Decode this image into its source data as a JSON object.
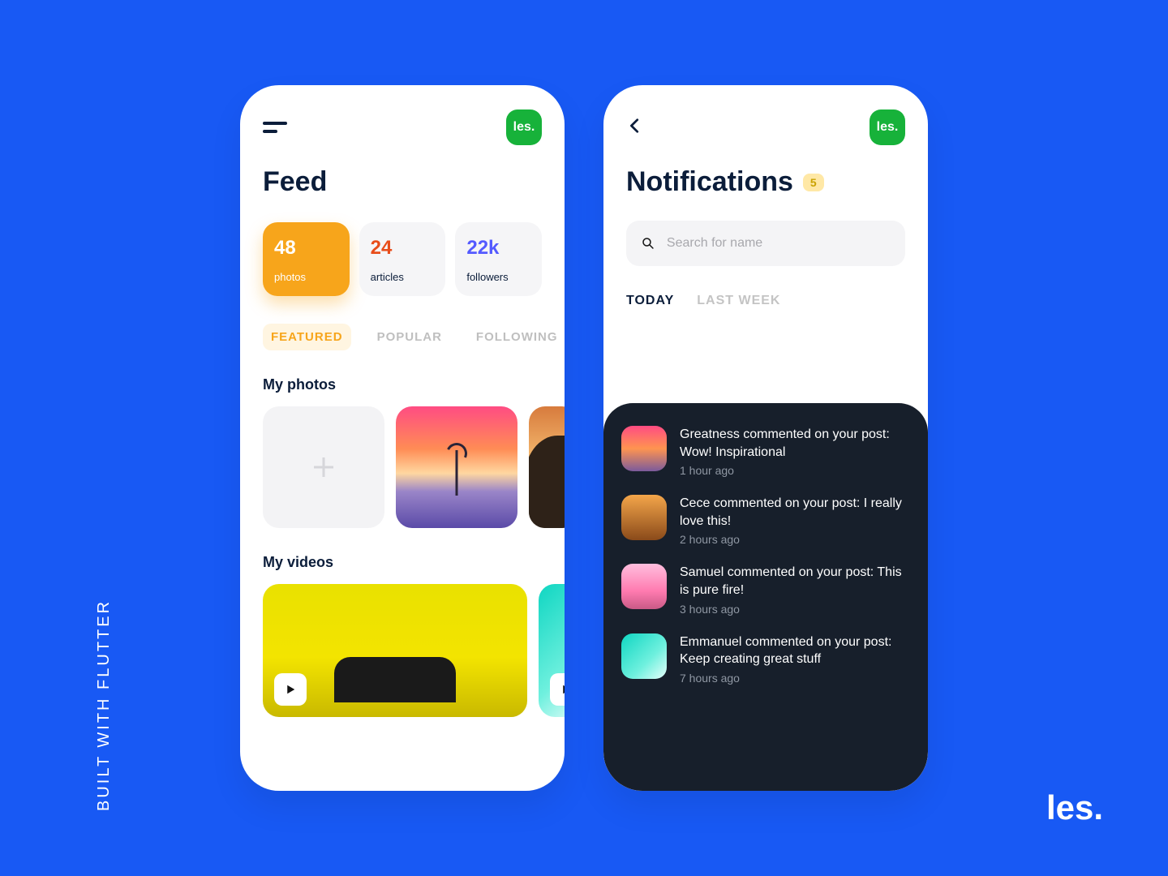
{
  "sidetext": "BUILT WITH FLUTTER",
  "footer_brand": "les.",
  "brand_chip": "les.",
  "feed": {
    "title": "Feed",
    "stats": {
      "photos": {
        "value": "48",
        "label": "photos"
      },
      "articles": {
        "value": "24",
        "label": "articles"
      },
      "followers": {
        "value": "22k",
        "label": "followers"
      }
    },
    "tabs": {
      "featured": "FEATURED",
      "popular": "POPULAR",
      "following": "FOLLOWING"
    },
    "sections": {
      "photos": "My photos",
      "videos": "My videos"
    }
  },
  "notifications": {
    "title": "Notifications",
    "badge": "5",
    "search_placeholder": "Search for name",
    "tabs": {
      "today": "TODAY",
      "last_week": "LAST WEEK"
    },
    "items": [
      {
        "text": "Greatness commented on your post: Wow! Inspirational",
        "time": "1 hour ago"
      },
      {
        "text": "Cece commented on your post: I really love this!",
        "time": "2 hours ago"
      },
      {
        "text": "Samuel commented on your post: This is pure fire!",
        "time": "3 hours ago"
      },
      {
        "text": "Emmanuel commented on your post: Keep creating great stuff",
        "time": "7 hours ago"
      }
    ]
  }
}
